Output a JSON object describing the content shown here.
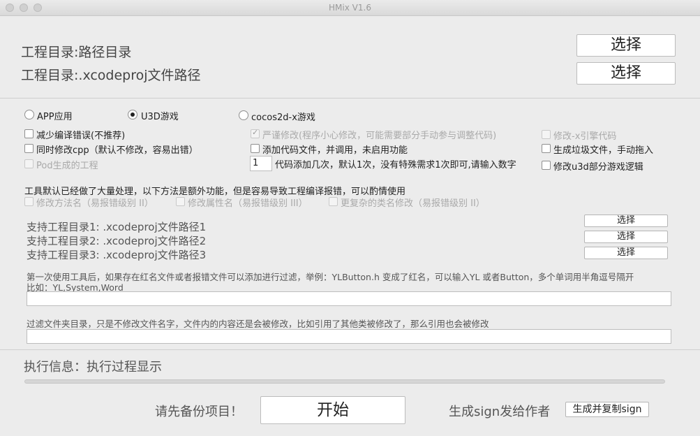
{
  "window": {
    "title": "HMix V1.6"
  },
  "project": {
    "dir_label": "工程目录:路径目录",
    "xcodeproj_label": "工程目录:.xcodeproj文件路径",
    "choose_dir": "选择",
    "choose_xcodeproj": "选择"
  },
  "engine": {
    "options": [
      {
        "label": "APP应用",
        "selected": false
      },
      {
        "label": "U3D游戏",
        "selected": true
      },
      {
        "label": "cocos2d-x游戏",
        "selected": false
      }
    ]
  },
  "options": {
    "reduce_errors": "减少编译错误(不推荐)",
    "modify_cpp": "同时修改cpp（默认不修改，容易出错）",
    "pod_project": "Pod生成的工程",
    "strict_modify": "严谨修改(程序小心修改，可能需要部分手动参与调整代码)",
    "add_code_files": "添加代码文件，并调用，未启用功能",
    "code_add_times_value": "1",
    "code_add_times_label": "代码添加几次，默认1次，没有特殊需求1次即可,请输入数字",
    "modify_x_engine": "修改-x引擎代码",
    "gen_garbage": "生成垃圾文件，手动拖入",
    "modify_u3d_logic": "修改u3d部分游戏逻辑"
  },
  "extra": {
    "notice": "工具默认已经做了大量处理，以下方法是额外功能，但是容易导致工程编译报错，可以酌情使用",
    "modify_method_names": "修改方法名（易报错级别 II）",
    "modify_property_names": "修改属性名（易报错级别 III）",
    "complex_class_rename": "更复杂的类名修改（易报错级别 II）"
  },
  "support": {
    "items": [
      {
        "label": "支持工程目录1: .xcodeproj文件路径1",
        "button": "选择"
      },
      {
        "label": "支持工程目录2: .xcodeproj文件路径2",
        "button": "选择"
      },
      {
        "label": "支持工程目录3: .xcodeproj文件路径3",
        "button": "选择"
      }
    ]
  },
  "filter": {
    "red_files_desc": "第一次使用工具后，如果存在红名文件或者报错文件可以添加进行过滤，举例：YLButton.h 变成了红名，可以输入YL 或者Button，多个单词用半角逗号隔开",
    "red_files_example": "比如：YL,System,Word",
    "red_files_value": "",
    "folder_desc": "过滤文件夹目录，只是不修改文件名字，文件内的内容还是会被修改，比如引用了其他类被修改了，那么引用也会被修改",
    "folder_value": ""
  },
  "status": {
    "exec_info": "执行信息：执行过程显示",
    "progress": 0
  },
  "footer": {
    "backup_notice": "请先备份项目！",
    "start": "开始",
    "sign_label": "生成sign发给作者",
    "sign_button": "生成并复制sign"
  },
  "colors": {
    "background": "#ececec",
    "text": "#222222",
    "disabled_text": "#a9a9a9"
  }
}
